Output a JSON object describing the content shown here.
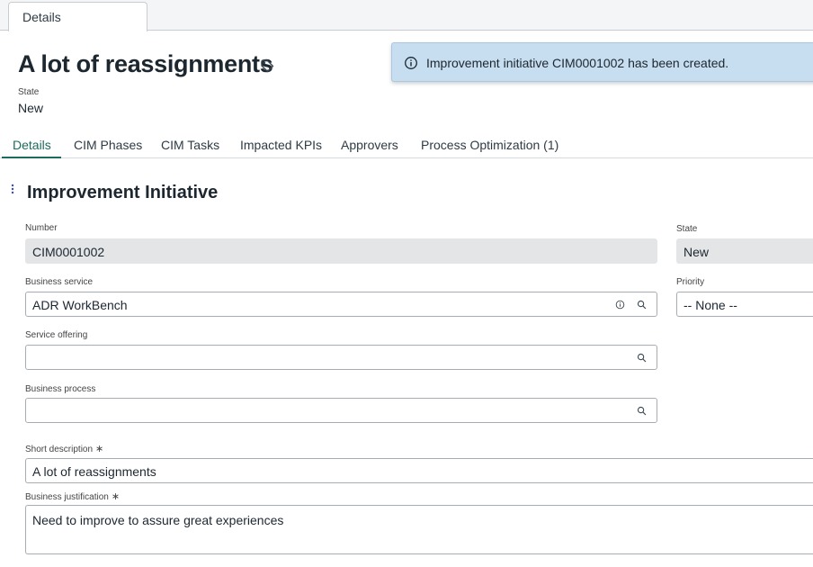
{
  "top_tab": {
    "label": "Details"
  },
  "record": {
    "title": "A lot of reassignments",
    "state_label": "State",
    "state_value": "New"
  },
  "toast": {
    "message": "Improvement initiative CIM0001002 has been created.",
    "icon": "info-icon"
  },
  "tabs": [
    {
      "label": "Details",
      "active": true
    },
    {
      "label": "CIM Phases"
    },
    {
      "label": "CIM Tasks"
    },
    {
      "label": "Impacted KPIs"
    },
    {
      "label": "Approvers"
    },
    {
      "label": "Process Optimization (1)"
    }
  ],
  "section": {
    "title": "Improvement Initiative"
  },
  "form": {
    "number": {
      "label": "Number",
      "value": "CIM0001002"
    },
    "state": {
      "label": "State",
      "value": "New"
    },
    "business_service": {
      "label": "Business service",
      "value": "ADR WorkBench"
    },
    "priority": {
      "label": "Priority",
      "value": "-- None --"
    },
    "service_offering": {
      "label": "Service offering",
      "value": ""
    },
    "business_process": {
      "label": "Business process",
      "value": ""
    },
    "short_description": {
      "label": "Short description",
      "required_mark": "∗",
      "value": "A lot of reassignments"
    },
    "business_justification": {
      "label": "Business justification",
      "required_mark": "∗",
      "value": "Need to improve to assure great experiences"
    }
  },
  "colors": {
    "accent": "#1d6b5b",
    "toast_bg": "#c6def0",
    "readonly_bg": "#e3e5e7"
  }
}
